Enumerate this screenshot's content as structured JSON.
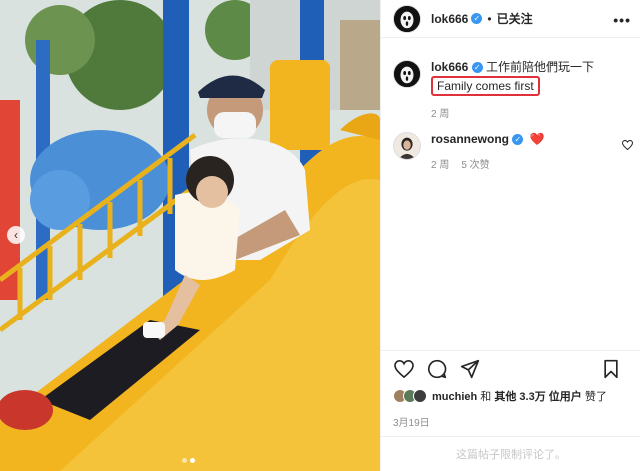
{
  "header": {
    "username": "lok666",
    "separator": "•",
    "follow_status": "已关注",
    "more_label": "•••"
  },
  "caption": {
    "username": "lok666",
    "text": "工作前陪他們玩一下",
    "highlight": "Family comes first",
    "age": "2 周"
  },
  "comment": {
    "username": "rosannewong",
    "text": "❤️",
    "age": "2 周",
    "likes": "5 次赞"
  },
  "actions": {
    "icons": [
      "heart-icon",
      "comment-icon",
      "share-icon",
      "bookmark-icon"
    ]
  },
  "likes": {
    "user": "muchieh",
    "joiner": "和",
    "others_prefix": "其他",
    "others_count": "3.3万",
    "others_suffix": "位用户",
    "verb": "赞了"
  },
  "date": "3月19日",
  "comments_limited": "这篇帖子限制评论了。",
  "carousel": {
    "pages": 2,
    "current": 2
  },
  "colors": {
    "highlight_box": "#e0303a",
    "verified": "#3897f0",
    "slide": "#f2b41f",
    "pole": "#1f5fb8"
  }
}
